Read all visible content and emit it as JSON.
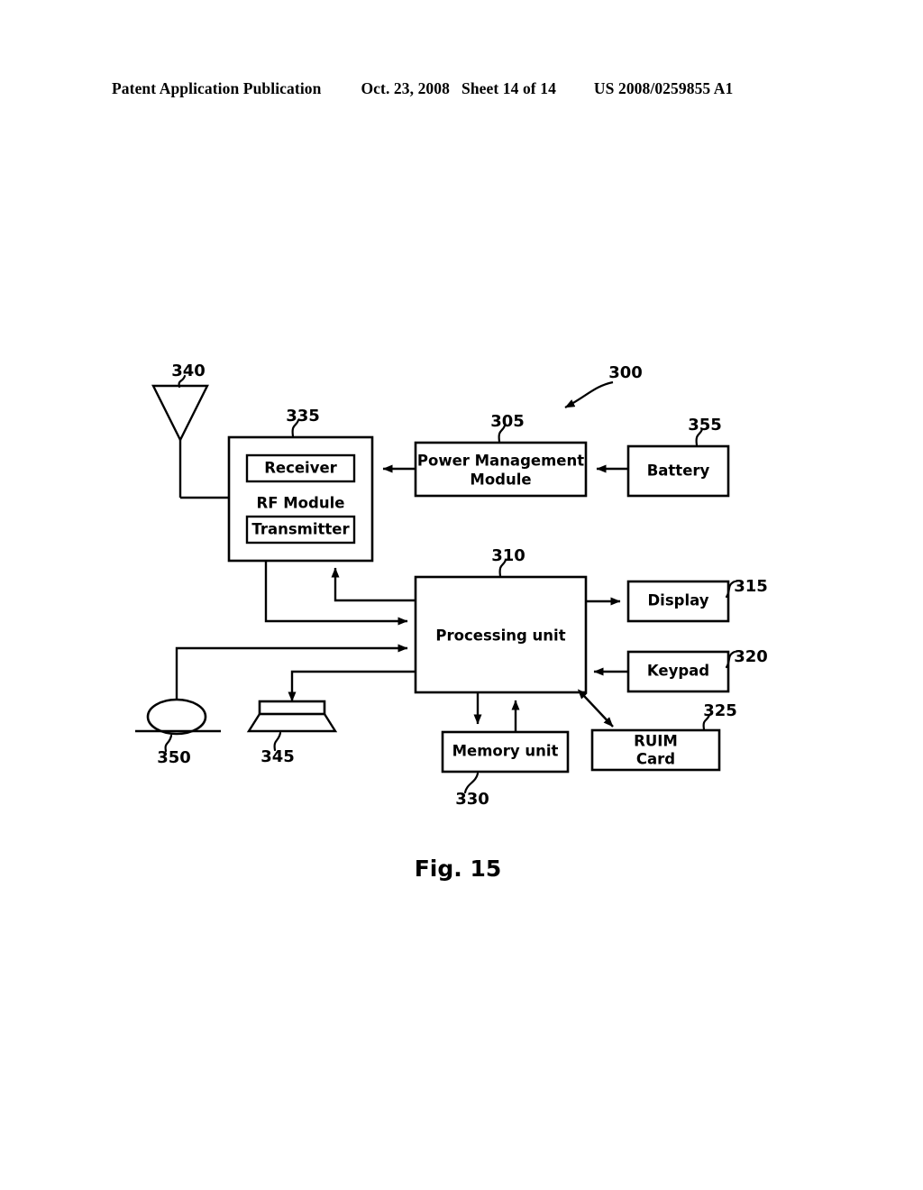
{
  "header": {
    "publication": "Patent Application Publication",
    "date": "Oct. 23, 2008",
    "sheet": "Sheet 14 of 14",
    "number": "US 2008/0259855 A1"
  },
  "figure": {
    "caption": "Fig. 15",
    "overall_ref": "300",
    "blocks": [
      {
        "id": "rf_module",
        "label": "RF Module",
        "ref": "335"
      },
      {
        "id": "receiver",
        "label": "Receiver",
        "ref": ""
      },
      {
        "id": "transmitter",
        "label": "Transmitter",
        "ref": ""
      },
      {
        "id": "power_mgmt",
        "label": "Power Management Module",
        "ref": "305"
      },
      {
        "id": "battery",
        "label": "Battery",
        "ref": "355"
      },
      {
        "id": "processing_unit",
        "label": "Processing unit",
        "ref": "310"
      },
      {
        "id": "display",
        "label": "Display",
        "ref": "315"
      },
      {
        "id": "keypad",
        "label": "Keypad",
        "ref": "320"
      },
      {
        "id": "ruim_card",
        "label": "RUIM Card",
        "ref": "325"
      },
      {
        "id": "memory_unit",
        "label": "Memory unit",
        "ref": "330"
      },
      {
        "id": "antenna",
        "label": "",
        "ref": "340"
      },
      {
        "id": "speaker",
        "label": "",
        "ref": "345"
      },
      {
        "id": "microphone",
        "label": "",
        "ref": "350"
      }
    ],
    "labels": {
      "rf_module": "RF Module",
      "receiver": "Receiver",
      "transmitter": "Transmitter",
      "power_mgmt_line1": "Power Management",
      "power_mgmt_line2": "Module",
      "battery": "Battery",
      "processing_unit": "Processing unit",
      "display": "Display",
      "keypad": "Keypad",
      "ruim_line1": "RUIM",
      "ruim_line2": "Card",
      "memory_unit": "Memory unit"
    },
    "refs": {
      "overall": "300",
      "power_mgmt": "305",
      "processing_unit": "310",
      "display": "315",
      "keypad": "320",
      "ruim_card": "325",
      "memory_unit": "330",
      "rf_module": "335",
      "antenna": "340",
      "speaker": "345",
      "microphone": "350",
      "battery": "355"
    }
  }
}
